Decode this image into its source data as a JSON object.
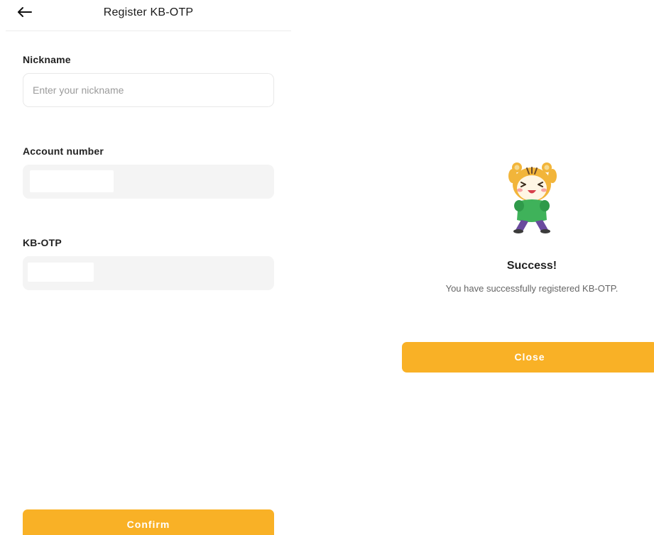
{
  "register_screen": {
    "title": "Register KB-OTP",
    "back_icon": "arrow-left-icon",
    "fields": {
      "nickname": {
        "label": "Nickname",
        "placeholder": "Enter your nickname",
        "value": ""
      },
      "account_number": {
        "label": "Account number"
      },
      "kb_otp": {
        "label": "KB-OTP"
      }
    },
    "confirm_label": "Confirm"
  },
  "success_screen": {
    "mascot_icon": "cheering-tiger-mascot",
    "title": "Success!",
    "message": "You have successfully registered KB-OTP.",
    "close_label": "Close"
  },
  "colors": {
    "accent": "#f9b126",
    "field_bg": "#f4f4f4",
    "divider": "#ececec"
  }
}
